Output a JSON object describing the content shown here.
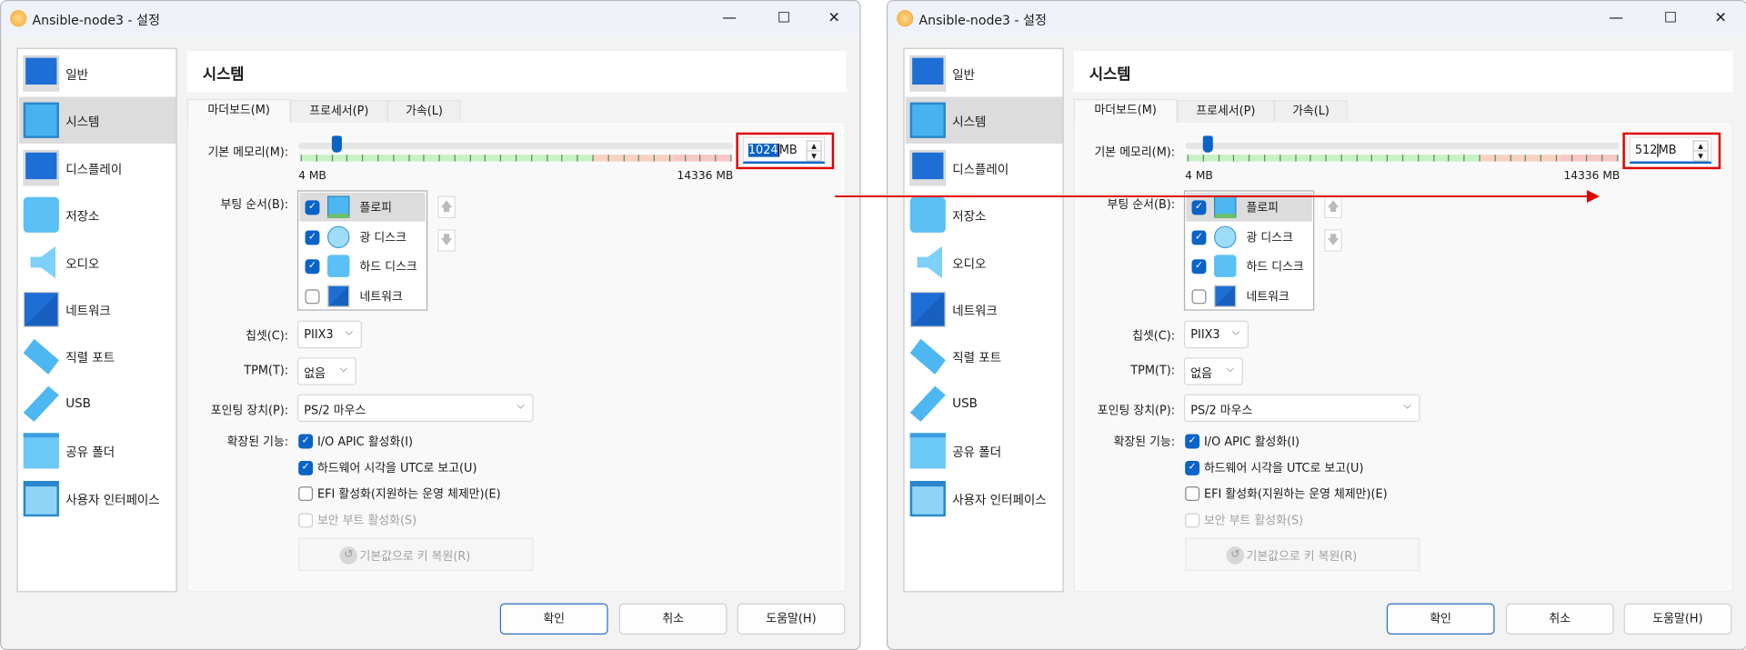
{
  "dialog": {
    "title": "Ansible-node3 - 설정",
    "controls": {
      "minimize": "—",
      "maximize": "☐",
      "close": "✕"
    },
    "sidebar": [
      {
        "label": "일반",
        "icon": "general-icon"
      },
      {
        "label": "시스템",
        "icon": "system-chip-icon",
        "selected": true
      },
      {
        "label": "디스플레이",
        "icon": "display-icon"
      },
      {
        "label": "저장소",
        "icon": "storage-icon"
      },
      {
        "label": "오디오",
        "icon": "audio-speaker-icon"
      },
      {
        "label": "네트워크",
        "icon": "network-icon"
      },
      {
        "label": "직렬 포트",
        "icon": "serial-port-icon"
      },
      {
        "label": "USB",
        "icon": "usb-icon"
      },
      {
        "label": "공유 폴더",
        "icon": "shared-folder-icon"
      },
      {
        "label": "사용자 인터페이스",
        "icon": "user-interface-icon"
      }
    ],
    "section_title": "시스템",
    "tabs": [
      {
        "label": "마더보드(M)",
        "selected": true
      },
      {
        "label": "프로세서(P)"
      },
      {
        "label": "가속(L)"
      }
    ],
    "memory": {
      "label": "기본 메모리(M):",
      "min_label": "4 MB",
      "max_label": "14336 MB",
      "unit": "MB",
      "min": 4,
      "max": 14336
    },
    "boot_order": {
      "label": "부팅 순서(B):",
      "items": [
        {
          "label": "플로피",
          "checked": true,
          "icon": "floppy-icon"
        },
        {
          "label": "광 디스크",
          "checked": true,
          "icon": "optical-disc-icon"
        },
        {
          "label": "하드 디스크",
          "checked": true,
          "icon": "hard-disk-icon"
        },
        {
          "label": "네트워크",
          "checked": false,
          "icon": "network-icon"
        }
      ],
      "up": "🡅",
      "down": "🡇"
    },
    "chipset": {
      "label": "칩셋(C):",
      "value": "PIIX3"
    },
    "tpm": {
      "label": "TPM(T):",
      "value": "없음"
    },
    "pointing": {
      "label": "포인팅 장치(P):",
      "value": "PS/2 마우스"
    },
    "extended": {
      "label": "확장된 기능:",
      "items": [
        {
          "label": "I/O APIC 활성화(I)",
          "state": "on"
        },
        {
          "label": "하드웨어 시각을 UTC로 보고(U)",
          "state": "on"
        },
        {
          "label": "EFI 활성화(지원하는 운영 체제만)(E)",
          "state": "off"
        },
        {
          "label": "보안 부트 활성화(S)",
          "state": "dis"
        }
      ]
    },
    "reset_keys": "기본값으로 키 복원(R)",
    "buttons": {
      "ok": "확인",
      "cancel": "취소",
      "help": "도움말(H)"
    }
  },
  "windows": [
    {
      "memory_value": "1024",
      "selected_text": true
    },
    {
      "memory_value": "512",
      "selected_text": false
    }
  ],
  "colors": {
    "accent": "#0a63c7",
    "highlight": "#e00000"
  }
}
